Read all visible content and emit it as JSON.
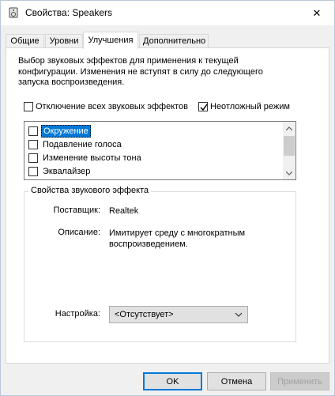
{
  "window": {
    "title": "Свойства: Speakers",
    "close_label": "✕"
  },
  "tabs": [
    {
      "label": "Общие"
    },
    {
      "label": "Уровни"
    },
    {
      "label": "Улучшения"
    },
    {
      "label": "Дополнительно"
    }
  ],
  "enhancements": {
    "description": "Выбор звуковых эффектов для применения к текущей конфигурации. Изменения не вступят в силу до следующего запуска воспроизведения.",
    "disable_all": {
      "label": "Отключение всех звуковых эффектов",
      "checked": false
    },
    "immediate_mode": {
      "label": "Неотложный режим",
      "checked": true
    },
    "effects": [
      {
        "label": "Окружение",
        "checked": false,
        "selected": true
      },
      {
        "label": "Подавление голоса",
        "checked": false,
        "selected": false
      },
      {
        "label": "Изменение высоты тона",
        "checked": false,
        "selected": false
      },
      {
        "label": "Эквалайзер",
        "checked": false,
        "selected": false
      }
    ],
    "properties": {
      "title": "Свойства звукового эффекта",
      "provider_label": "Поставщик:",
      "provider_value": "Realtek",
      "description_label": "Описание:",
      "description_value": "Имитирует среду с многократным воспроизведением.",
      "setting_label": "Настройка:",
      "setting_value": "<Отсутствует>"
    }
  },
  "buttons": {
    "ok": "OK",
    "cancel": "Отмена",
    "apply": "Применить"
  },
  "colors": {
    "selection": "#0078d7",
    "window_bg": "#f0f0f0"
  }
}
